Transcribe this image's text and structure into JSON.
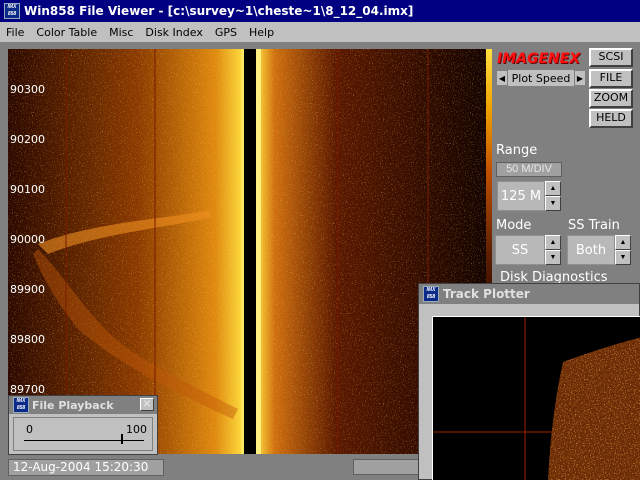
{
  "window": {
    "title": "Win858 File Viewer - [c:\\survey~1\\cheste~1\\8_12_04.imx]",
    "icon_text": "IMX 858"
  },
  "menu": [
    "File",
    "Color Table",
    "Misc",
    "Disk Index",
    "GPS",
    "Help"
  ],
  "sonar": {
    "depth_labels": [
      "90300",
      "90200",
      "90100",
      "90000",
      "89900",
      "89800",
      "89700"
    ]
  },
  "panel": {
    "logo": "IMAGENEX",
    "plot_speed_label": "Plot Speed",
    "buttons": [
      "SCSI",
      "FILE",
      "ZOOM",
      "HELD"
    ],
    "range_heading": "Range",
    "range_div": "50 M/DIV",
    "range_value": "125 M",
    "mode_heading": "Mode",
    "mode_value": "SS",
    "sstrain_heading": "SS Train",
    "sstrain_value": "Both",
    "disk_diag_heading": "Disk Diagnostics"
  },
  "status": {
    "datetime": "12-Aug-2004  15:20:30"
  },
  "playback": {
    "title": "File Playback",
    "min_label": "0",
    "max_label": "100",
    "position": 0.82
  },
  "track_plotter": {
    "title": "Track Plotter"
  },
  "colors": {
    "accent": "#000080",
    "logo": "#ff1010",
    "sonar_hot": "#ffd000"
  }
}
